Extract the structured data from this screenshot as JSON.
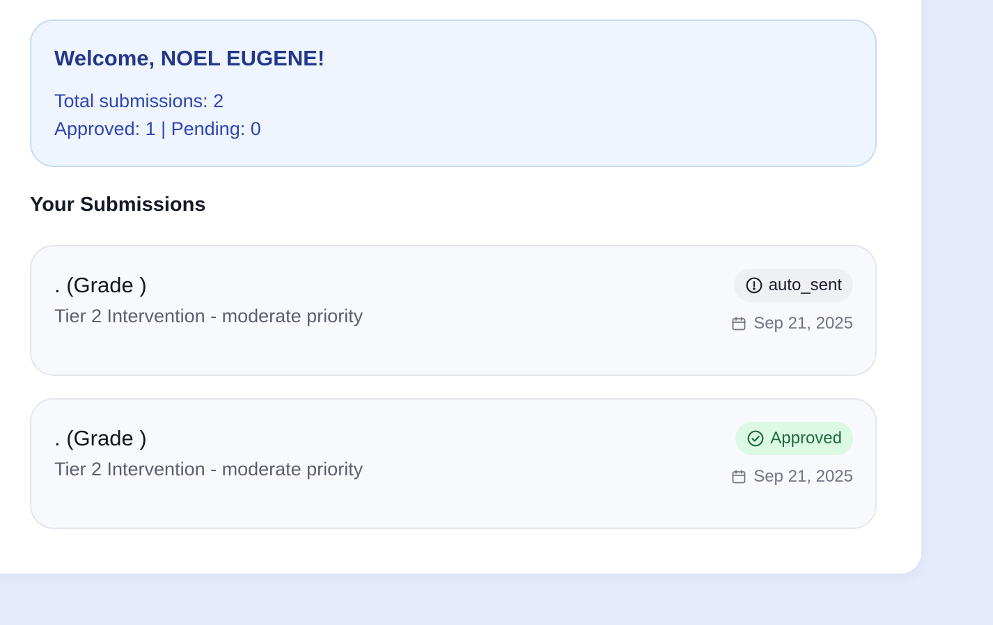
{
  "welcome": {
    "title": "Welcome, NOEL EUGENE!",
    "total_line": "Total submissions: 2",
    "status_line": "Approved: 1 | Pending: 0"
  },
  "section": {
    "title": "Your Submissions"
  },
  "submissions": [
    {
      "title": ". (Grade )",
      "description": "Tier 2 Intervention - moderate priority",
      "status": "auto_sent",
      "status_icon": "alert-circle-icon",
      "date": "Sep 21, 2025"
    },
    {
      "title": ". (Grade )",
      "description": "Tier 2 Intervention - moderate priority",
      "status": "Approved",
      "status_icon": "check-circle-icon",
      "date": "Sep 21, 2025"
    }
  ],
  "colors": {
    "page_background": "#e4eafb",
    "welcome_background": "#eef5ff",
    "welcome_title": "#24378a",
    "welcome_text": "#2e45b0",
    "approved_badge_bg": "#dcf9e4",
    "approved_badge_text": "#216a3c",
    "auto_badge_bg": "#eef0f4"
  }
}
